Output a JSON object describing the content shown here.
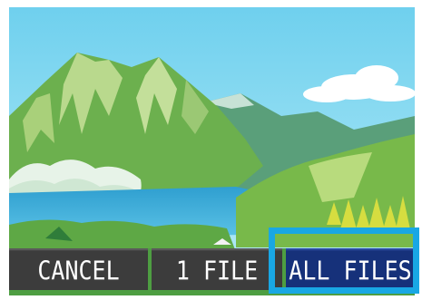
{
  "buttons": {
    "cancel": "CANCEL",
    "one_file": "1 FILE",
    "all_files": "ALL FILES"
  },
  "selected_button": "all_files",
  "colors": {
    "button_bg": "#3c3c3c",
    "selected_bg": "#16317a",
    "highlight": "#19a7e4",
    "button_text": "#ffffff"
  }
}
